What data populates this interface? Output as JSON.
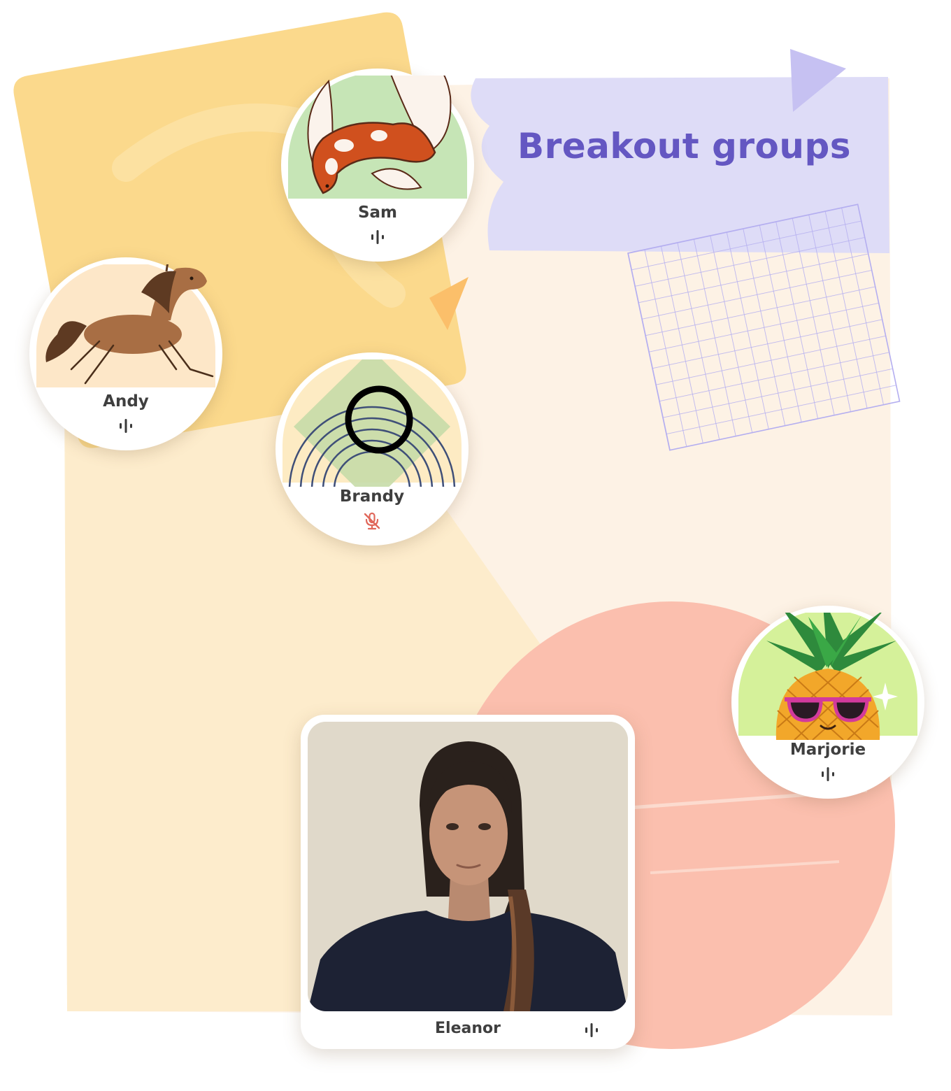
{
  "header": {
    "title": "Breakout groups"
  },
  "participants": [
    {
      "id": "sam",
      "name": "Sam",
      "avatar_icon": "koi-fish-icon",
      "mic_status": "active",
      "mic_icon": "audio-level-icon"
    },
    {
      "id": "andy",
      "name": "Andy",
      "avatar_icon": "horse-icon",
      "mic_status": "active",
      "mic_icon": "audio-level-icon"
    },
    {
      "id": "brandy",
      "name": "Brandy",
      "avatar_icon": "rainbow-circle-icon",
      "mic_status": "muted",
      "mic_icon": "mic-muted-icon"
    },
    {
      "id": "marjorie",
      "name": "Marjorie",
      "avatar_icon": "pineapple-sunglasses-icon",
      "mic_status": "active",
      "mic_icon": "audio-level-icon"
    },
    {
      "id": "eleanor",
      "name": "Eleanor",
      "avatar_icon": "camera-video-feed",
      "mic_status": "active",
      "mic_icon": "audio-level-icon"
    }
  ],
  "colors": {
    "title": "#6457c2",
    "muted_mic": "#e0675a",
    "active_mic": "#3a3a3a",
    "yellow_panel": "#fbd98c",
    "lavender_brush": "#dddcf6",
    "coral_circle": "#fbbcaa"
  }
}
